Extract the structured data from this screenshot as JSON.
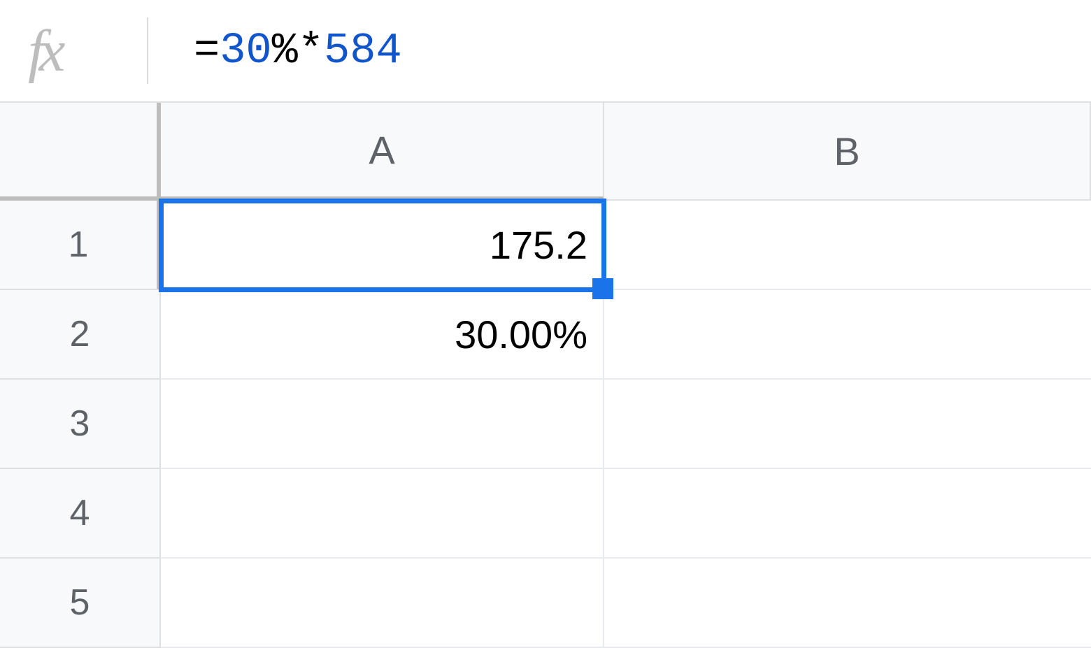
{
  "formula_bar": {
    "formula": {
      "eq": "=",
      "num1": "30",
      "pct_star": "%*",
      "num2": "584"
    }
  },
  "columns": [
    "A",
    "B"
  ],
  "rows": [
    "1",
    "2",
    "3",
    "4",
    "5"
  ],
  "cells": {
    "A1": "175.2",
    "A2": "30.00%",
    "A3": "",
    "A4": "",
    "A5": "",
    "B1": "",
    "B2": "",
    "B3": "",
    "B4": "",
    "B5": ""
  },
  "selected_cell": "A1"
}
